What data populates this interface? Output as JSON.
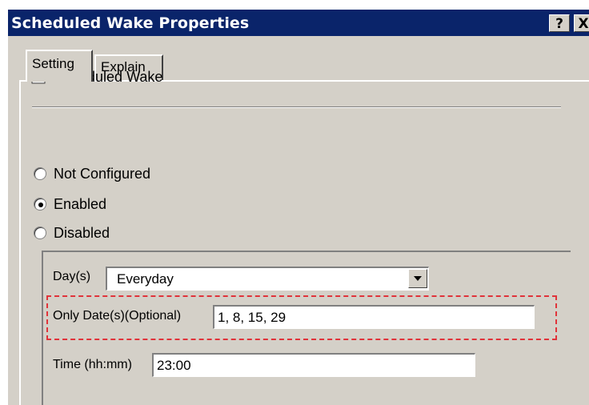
{
  "window": {
    "title": "Scheduled Wake Properties",
    "help_label": "?",
    "close_label": "X"
  },
  "tabs": [
    {
      "label": "Setting",
      "selected": true
    },
    {
      "label": "Explain",
      "selected": false
    }
  ],
  "policy": {
    "icon": "policy-setting-icon",
    "name": "Scheduled Wake"
  },
  "state_options": [
    {
      "label": "Not Configured",
      "checked": false
    },
    {
      "label": "Enabled",
      "checked": true
    },
    {
      "label": "Disabled",
      "checked": false
    }
  ],
  "options": {
    "days_label": "Day(s)",
    "days_value": "Everyday",
    "dates_label": "Only Date(s)(Optional)",
    "dates_value": "1, 8, 15, 29",
    "time_label": "Time (hh:mm)",
    "time_value": "23:00"
  },
  "colors": {
    "titlebar": "#0a246a",
    "dialog_bg": "#d4d0c8",
    "highlight": "#e0333a"
  }
}
